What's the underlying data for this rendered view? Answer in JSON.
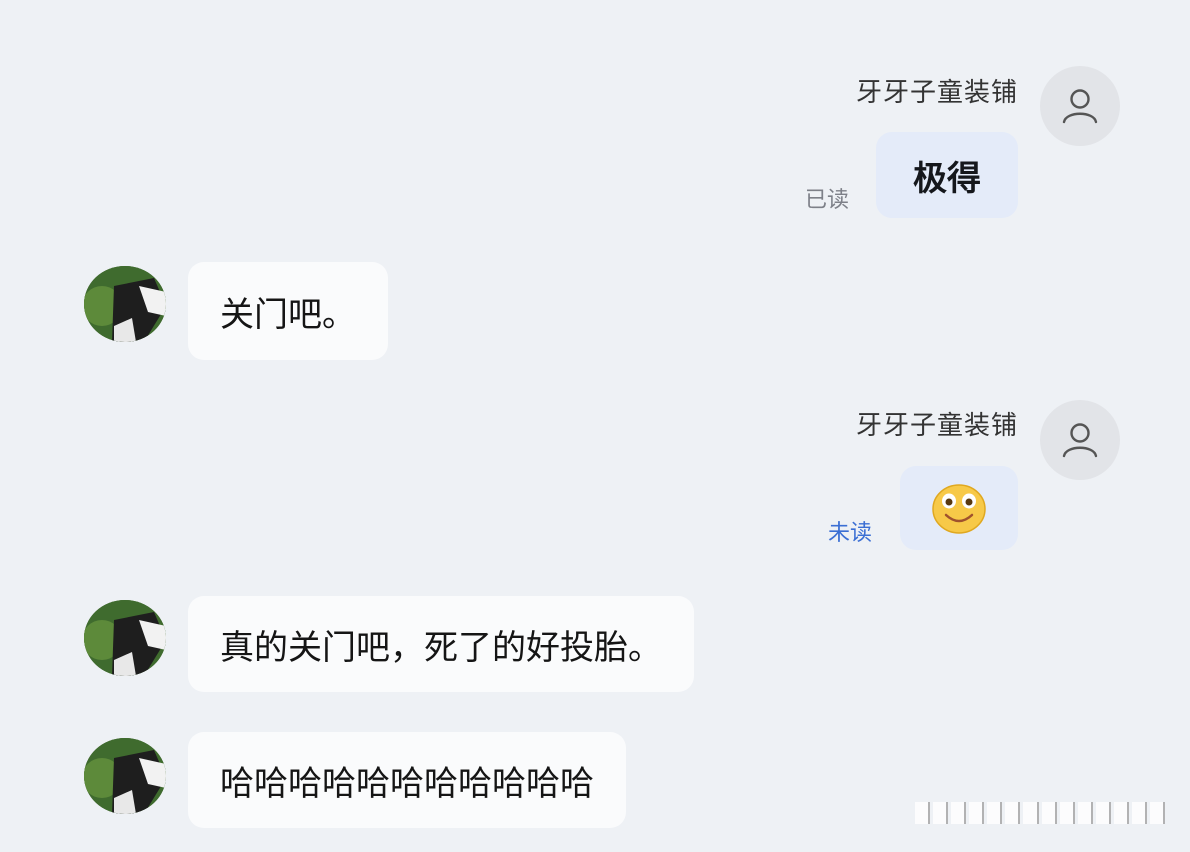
{
  "conversation": {
    "messages": [
      {
        "side": "right",
        "sender": "牙牙子童装铺",
        "text": "极得",
        "status": "已读"
      },
      {
        "side": "left",
        "text": "关门吧。"
      },
      {
        "side": "right",
        "sender": "牙牙子童装铺",
        "emoji": "smile-emoji",
        "status": "未读"
      },
      {
        "side": "left",
        "text": "真的关门吧，死了的好投胎。"
      },
      {
        "side": "left",
        "text": "哈哈哈哈哈哈哈哈哈哈哈"
      }
    ]
  },
  "colors": {
    "background": "#eef1f5",
    "bubble_right": "#e4ebf9",
    "bubble_left": "#fafbfc",
    "unread": "#3b6fd4",
    "read": "#7d8088"
  }
}
